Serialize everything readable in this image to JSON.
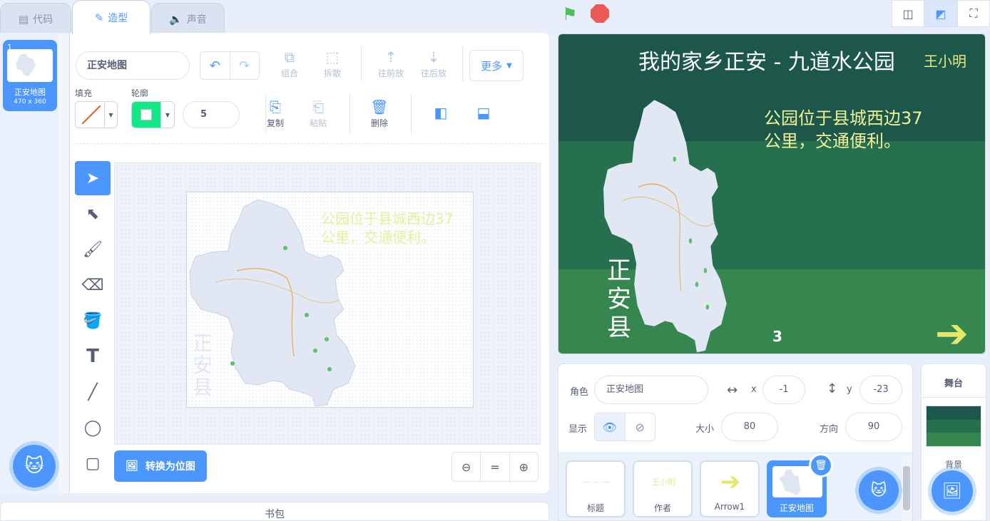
{
  "tabs": [
    {
      "label": "代码",
      "icon": "code-icon"
    },
    {
      "label": "造型",
      "icon": "brush-icon"
    },
    {
      "label": "声音",
      "icon": "speaker-icon"
    }
  ],
  "costume_list": {
    "items": [
      {
        "number": "1",
        "name": "正安地图",
        "size": "470 x 360"
      }
    ]
  },
  "editor": {
    "costume_name": "正安地图",
    "toolbar": {
      "group": "组合",
      "ungroup": "拆散",
      "forward": "往前放",
      "backward": "往后放",
      "more": "更多",
      "copy": "复制",
      "paste": "粘贴",
      "delete": "删除"
    },
    "fill_label": "填充",
    "outline_label": "轮廓",
    "stroke_width": "5",
    "canvas_text": [
      "公园位于县城西边37",
      "公里，交通便利。"
    ],
    "canvas_vtext": [
      "正",
      "安",
      "县"
    ],
    "convert_button": "转换为位图"
  },
  "backpack": {
    "label": "书包"
  },
  "stage": {
    "title": "我的家乡正安 - 九道水公园",
    "author": "王小明",
    "text": [
      "公园位于县城西边37",
      "公里，交通便利。"
    ],
    "vtext": [
      "正",
      "安",
      "县"
    ],
    "number": "3"
  },
  "sprite_info": {
    "sprite_label": "角色",
    "sprite_name": "正安地图",
    "x_label": "x",
    "x": "-1",
    "y_label": "y",
    "y": "-23",
    "show_label": "显示",
    "size_label": "大小",
    "size": "80",
    "direction_label": "方向",
    "direction": "90"
  },
  "sprites": [
    {
      "name": "标题",
      "thumb": "— — —"
    },
    {
      "name": "作者",
      "thumb": "王小明"
    },
    {
      "name": "Arrow1",
      "thumb": "➔"
    },
    {
      "name": "正安地图",
      "thumb": ""
    }
  ],
  "stage_panel": {
    "title": "舞台",
    "backdrops_label": "背景"
  },
  "colors": {
    "accent": "#4c97ff",
    "stage_dark": "#1c574a",
    "stage_mid": "#27704f",
    "stage_light": "#36874f",
    "outline_green": "#10ea86"
  }
}
